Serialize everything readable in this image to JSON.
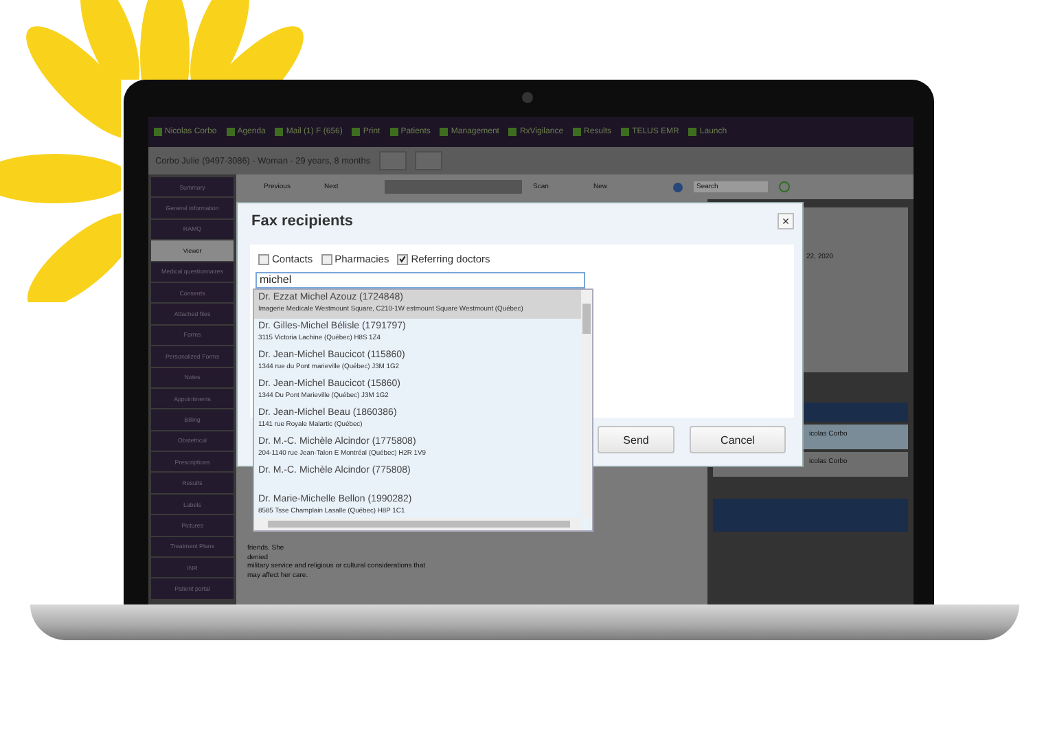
{
  "top_nav": [
    {
      "label": "Nicolas Corbo"
    },
    {
      "label": "Agenda"
    },
    {
      "label": "Mail (1) F (656)"
    },
    {
      "label": "Print"
    },
    {
      "label": "Patients"
    },
    {
      "label": "Management"
    },
    {
      "label": "RxVigilance"
    },
    {
      "label": "Results"
    },
    {
      "label": "TELUS EMR"
    },
    {
      "label": "Launch"
    }
  ],
  "patient_header": {
    "title": "Corbo Julie (9497-3086) - Woman - 29 years, 8 months"
  },
  "sidebar": {
    "items": [
      {
        "label": "Summary",
        "selected": false
      },
      {
        "label": "General information",
        "selected": false
      },
      {
        "label": "RAMQ",
        "selected": false
      },
      {
        "label": "Viewer",
        "selected": true
      },
      {
        "label": "Medical questionnaires",
        "selected": false
      },
      {
        "label": "Consents",
        "selected": false
      },
      {
        "label": "Attached files",
        "selected": false
      },
      {
        "label": "Forms",
        "selected": false
      },
      {
        "label": "Personalized Forms",
        "selected": false
      },
      {
        "label": "Notes",
        "selected": false
      },
      {
        "label": "Appointments",
        "selected": false
      },
      {
        "label": "Billing",
        "selected": false
      },
      {
        "label": "Obstetrical",
        "selected": false
      },
      {
        "label": "Prescriptions",
        "selected": false
      },
      {
        "label": "Results",
        "selected": false
      },
      {
        "label": "Labels",
        "selected": false
      },
      {
        "label": "Pictures",
        "selected": false
      },
      {
        "label": "Treatment Plans",
        "selected": false
      },
      {
        "label": "INR",
        "selected": false
      },
      {
        "label": "Patient portal",
        "selected": false
      }
    ]
  },
  "toolbar": {
    "previous": "Previous",
    "next": "Next",
    "scan": "Scan",
    "new": "New",
    "search": {
      "placeholder": "Search"
    }
  },
  "notes_text": [
    "friends. She",
    "denied",
    "military service and religious or cultural considerations that",
    "may affect her care."
  ],
  "right_panel": {
    "date": "22, 2020",
    "authors": [
      "icolas Corbo",
      "icolas Corbo"
    ]
  },
  "dialog": {
    "title": "Fax recipients",
    "close": "×",
    "filters": [
      {
        "label": "Contacts",
        "checked": false
      },
      {
        "label": "Pharmacies",
        "checked": false
      },
      {
        "label": "Referring doctors",
        "checked": true
      }
    ],
    "search": {
      "value": "michel"
    },
    "results": [
      {
        "name": "Dr. Ezzat Michel Azouz (1724848)",
        "address": "Imagerie Medicale Westmount Square, C210-1W estmount Square Westmount (Québec)",
        "selected": true
      },
      {
        "name": "Dr. Gilles-Michel Bélisle (1791797)",
        "address": "3115 Victoria Lachine (Québec) H8S 1Z4",
        "selected": false
      },
      {
        "name": "Dr. Jean-Michel Baucicot (115860)",
        "address": "1344 rue du Pont marieville (Québec) J3M 1G2",
        "selected": false
      },
      {
        "name": "Dr. Jean-Michel Baucicot (15860)",
        "address": "1344 Du Pont Marieville (Québec) J3M 1G2",
        "selected": false
      },
      {
        "name": "Dr. Jean-Michel Beau (1860386)",
        "address": "1141 rue Royale Malartic (Québec)",
        "selected": false
      },
      {
        "name": "Dr. M.-C. Michèle Alcindor (1775808)",
        "address": "204-1140 rue Jean-Talon E Montréal (Québec) H2R 1V9",
        "selected": false
      },
      {
        "name": "Dr. M.-C. Michèle Alcindor (775808)",
        "selected": false
      },
      {
        "name": "Dr. Marie-Michelle Bellon (1990282)",
        "address": "8585 Tsse Champlain Lasalle (Québec) H8P 1C1",
        "selected": false
      }
    ],
    "buttons": [
      "Send",
      "Cancel"
    ]
  }
}
